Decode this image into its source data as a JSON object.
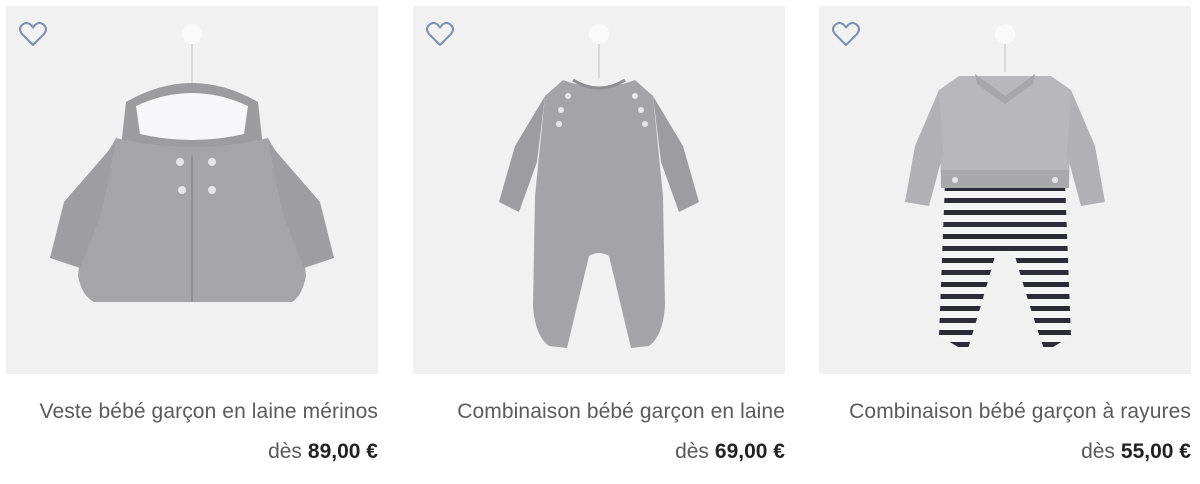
{
  "products": [
    {
      "name": "Veste bébé garçon en laine mérinos",
      "price_prefix": "dès",
      "price": "89,00 €",
      "image_desc": "grey hooded knit jacket"
    },
    {
      "name": "Combinaison bébé garçon en laine",
      "price_prefix": "dès",
      "price": "69,00 €",
      "image_desc": "grey knit jumpsuit"
    },
    {
      "name": "Combinaison bébé garçon à rayures",
      "price_prefix": "dès",
      "price": "55,00 €",
      "image_desc": "grey top with striped leggings jumpsuit"
    }
  ],
  "colors": {
    "photo_bg": "#f1f1f1",
    "heart": "#7b8fae",
    "text": "#5a5a5a",
    "price": "#222222"
  },
  "icons": {
    "wishlist": "heart-outline-icon"
  }
}
